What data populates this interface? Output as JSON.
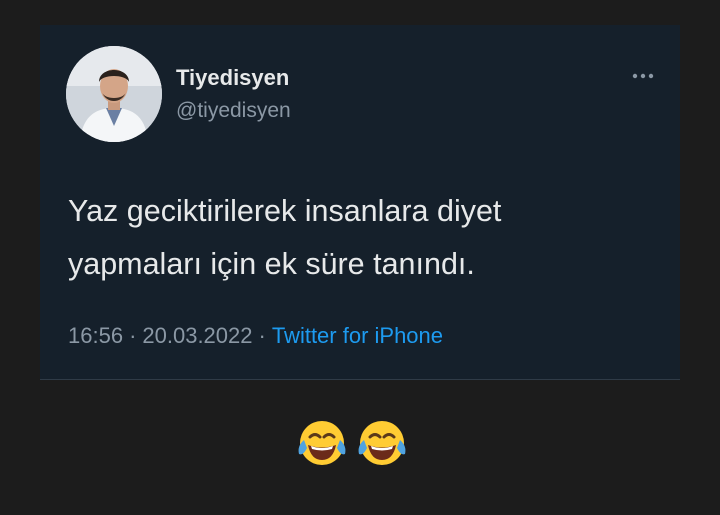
{
  "tweet": {
    "display_name": "Tiyedisyen",
    "handle": "@tiyedisyen",
    "text_line_1": "Yaz geciktirilerek insanlara diyet",
    "text_line_2": "yapmaları için ek süre tanındı.",
    "time": "16:56",
    "separator": "·",
    "date": "20.03.2022",
    "source": "Twitter for iPhone"
  },
  "icons": {
    "more": "more-horizontal-icon",
    "emoji": "face-with-tears-of-joy-icon"
  },
  "colors": {
    "background": "#1c1c1c",
    "card": "#15202b",
    "text": "#e7e9ea",
    "secondary_text": "#8b98a5",
    "link": "#1d9bf0"
  }
}
